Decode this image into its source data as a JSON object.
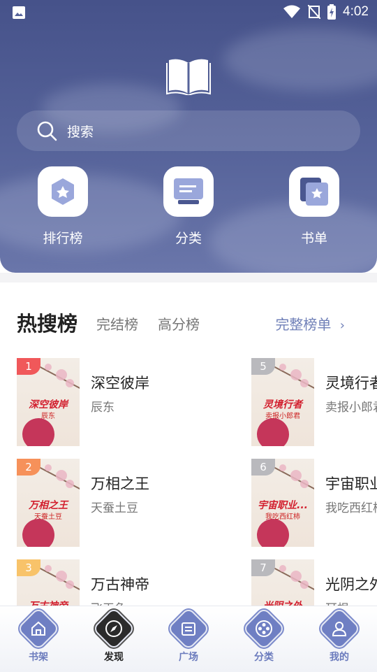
{
  "status": {
    "time": "4:02"
  },
  "search": {
    "placeholder": "搜索"
  },
  "quick_actions": [
    {
      "label": "排行榜",
      "icon": "ranking-icon"
    },
    {
      "label": "分类",
      "icon": "category-icon"
    },
    {
      "label": "书单",
      "icon": "booklist-icon"
    }
  ],
  "tabs": {
    "active": "热搜榜",
    "completed": "完结榜",
    "high_score": "高分榜",
    "full_list": "完整榜单"
  },
  "books": [
    {
      "rank": "1",
      "title": "深空彼岸",
      "author": "辰东",
      "cover_title": "深空彼岸",
      "cover_author": "辰东",
      "rank_color": "#f0585a"
    },
    {
      "rank": "2",
      "title": "万相之王",
      "author": "天蚕土豆",
      "cover_title": "万相之王",
      "cover_author": "天蚕土豆",
      "rank_color": "#f6915a"
    },
    {
      "rank": "3",
      "title": "万古神帝",
      "author": "飞天鱼",
      "cover_title": "万古神帝",
      "cover_author": "",
      "rank_color": "#f8c36a"
    },
    {
      "rank": "5",
      "title": "灵境行者",
      "author": "卖报小郎君",
      "cover_title": "灵境行者",
      "cover_author": "卖报小郎君",
      "rank_color": "#b9b9bd"
    },
    {
      "rank": "6",
      "title": "宇宙职业",
      "author": "我吃西红柿",
      "cover_title": "宇宙职业...",
      "cover_author": "我吃西红柿",
      "rank_color": "#b9b9bd"
    },
    {
      "rank": "7",
      "title": "光阴之外",
      "author": "耳根",
      "cover_title": "光阴之外",
      "cover_author": "",
      "rank_color": "#b9b9bd"
    }
  ],
  "bottom_nav": [
    {
      "label": "书架",
      "icon": "bookshelf-icon"
    },
    {
      "label": "发现",
      "icon": "compass-icon",
      "active": true
    },
    {
      "label": "广场",
      "icon": "plaza-icon"
    },
    {
      "label": "分类",
      "icon": "category-icon"
    },
    {
      "label": "我的",
      "icon": "profile-icon"
    }
  ],
  "colors": {
    "header": "#56639a",
    "accent": "#7080b8"
  }
}
